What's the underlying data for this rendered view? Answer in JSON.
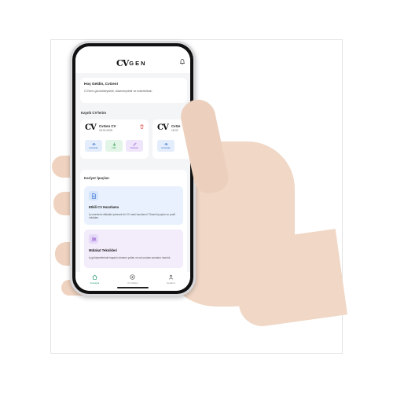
{
  "app": {
    "logo_mark": "CV",
    "logo_text": "GEN"
  },
  "welcome": {
    "title": "Hoş Geldin, CvGen!",
    "subtitle": "CV'lerin görüntüleyebilir, düzenleyebilir ve indirebilirsin"
  },
  "saved_cvs": {
    "section_title": "Kayıtlı CV'lerim",
    "items": [
      {
        "logo": "CV",
        "name": "CvGen CV",
        "date": "18.02.2025",
        "actions": [
          "Görüntüle",
          "İndir",
          "Düzenle"
        ]
      },
      {
        "logo": "CV",
        "name": "CvGe",
        "date": "18.02",
        "actions": [
          "Görüntüle"
        ]
      }
    ]
  },
  "career_tips": {
    "section_title": "Kariyer İpuçları",
    "items": [
      {
        "icon": "document-icon",
        "title": "Etkili CV Hazırlama",
        "description": "İş verenlerin dikkatini çekecek bir CV nasıl hazırlanır? Önemli ipuçları ve profil noktaları."
      },
      {
        "icon": "people-icon",
        "title": "Mülakat Teknikleri",
        "description": "İş görüşmelerinde başarılı olmanın yolları ve sık sorulan soruların hazırlık."
      }
    ]
  },
  "bottom_nav": {
    "items": [
      {
        "icon": "home-icon",
        "label": "Anasayfa",
        "active": true
      },
      {
        "icon": "plus-circle-icon",
        "label": "CV Oluştur",
        "active": false
      },
      {
        "icon": "user-icon",
        "label": "Hesabım",
        "active": false
      }
    ]
  },
  "colors": {
    "accent": "#2a9a74",
    "view": "#3b6fd0",
    "download": "#2e9a4d",
    "edit": "#8a4ad0",
    "delete": "#e0453a"
  }
}
